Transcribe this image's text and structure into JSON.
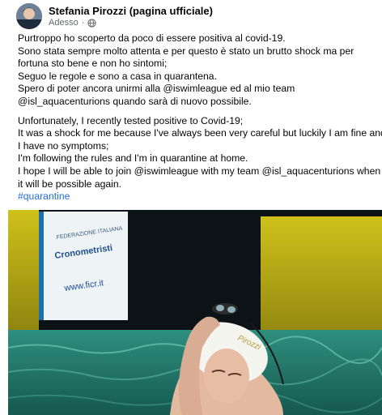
{
  "post": {
    "author": "Stefania Pirozzi (pagina ufficiale)",
    "timestamp": "Adesso",
    "privacy_icon": "globe-icon",
    "lines_it": [
      "Purtroppo ho scoperto da poco di essere positiva al covid-19.",
      "Sono stata sempre molto attenta e per questo è stato un brutto shock ma per",
      "fortuna sto bene e non ho sintomi;",
      "Seguo le regole e sono a casa in quarantena.",
      "Spero di poter ancora unirmi alla @iswimleague ed al mio team",
      "@isl_aquacenturions quando sarà di nuovo  possibile."
    ],
    "lines_en": [
      "Unfortunately, I recently tested positive to Covid-19;",
      "It was a shock for me because I've always been very careful but luckily I am fine and",
      "I have no symptoms;",
      "I'm following the rules and I'm in quarantine at home.",
      "I hope I will be able to join @iswimleague with my team @isl_aquacenturions when",
      "it will be possible again."
    ],
    "hashtag": "#quarantine"
  },
  "photo": {
    "banner_lines": [
      "FEDERAZIONE ITALIANA",
      "Cronometristi",
      "www.ficr.it"
    ],
    "cap_text": "Pirozzi"
  }
}
